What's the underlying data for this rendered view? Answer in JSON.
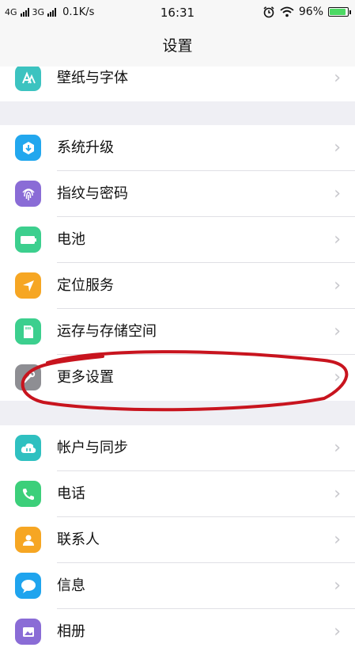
{
  "status": {
    "net1": "4G",
    "net2": "3G",
    "speed": "0.1K/s",
    "time": "16:31",
    "battery": "96%",
    "battery_level": 0.96
  },
  "title": "设置",
  "groups": [
    {
      "rows": [
        {
          "label": "壁纸与字体",
          "icon": "wallpaper-font-icon",
          "color": "#3cc3c0"
        }
      ]
    },
    {
      "rows": [
        {
          "label": "系统升级",
          "icon": "system-update-icon",
          "color": "#22a7ee"
        },
        {
          "label": "指纹与密码",
          "icon": "fingerprint-icon",
          "color": "#8a6cd6"
        },
        {
          "label": "电池",
          "icon": "battery-icon",
          "color": "#3ccf8e"
        },
        {
          "label": "定位服务",
          "icon": "location-icon",
          "color": "#f6a623"
        },
        {
          "label": "运存与存储空间",
          "icon": "storage-icon",
          "color": "#3ccf8e"
        },
        {
          "label": "更多设置",
          "icon": "more-settings-icon",
          "color": "#8e8e93"
        }
      ]
    },
    {
      "rows": [
        {
          "label": "帐户与同步",
          "icon": "cloud-sync-icon",
          "color": "#2fc0c0"
        },
        {
          "label": "电话",
          "icon": "phone-icon",
          "color": "#3ccf7a"
        },
        {
          "label": "联系人",
          "icon": "contacts-icon",
          "color": "#f6a623"
        },
        {
          "label": "信息",
          "icon": "message-icon",
          "color": "#1fa4ee"
        },
        {
          "label": "相册",
          "icon": "album-icon",
          "color": "#8a6cd6"
        }
      ]
    }
  ],
  "chevron": "›",
  "annotation_color": "#c8141e"
}
